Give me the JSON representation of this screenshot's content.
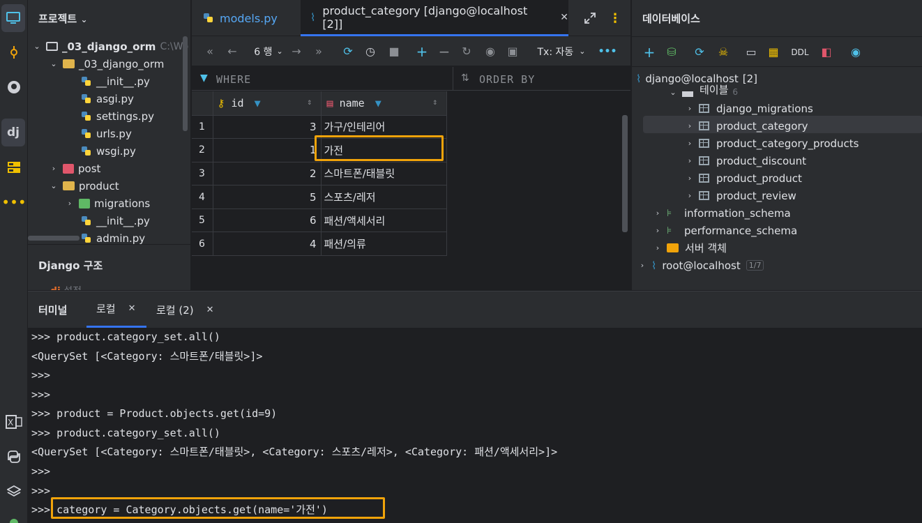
{
  "project": {
    "title": "프로젝트",
    "root": "_03_django_orm",
    "root_path": "C:\\Wo",
    "items": [
      "_03_django_orm",
      "__init__.py",
      "asgi.py",
      "settings.py",
      "urls.py",
      "wsgi.py",
      "post",
      "product",
      "migrations",
      "__init__.py",
      "admin.py"
    ],
    "django_structure": "Django 구조",
    "django_sub": "설정"
  },
  "editor": {
    "tabs": [
      "models.py",
      "product_category [django@localhost [2]]"
    ],
    "row_count": "6 행",
    "tx_label": "Tx: 자동",
    "where_label": "WHERE",
    "orderby_label": "ORDER BY",
    "columns": [
      "id",
      "name"
    ],
    "rows": [
      {
        "n": "1",
        "id": "3",
        "name": "가구/인테리어"
      },
      {
        "n": "2",
        "id": "1",
        "name": "가전"
      },
      {
        "n": "3",
        "id": "2",
        "name": "스마트폰/태블릿"
      },
      {
        "n": "4",
        "id": "5",
        "name": "스포츠/레저"
      },
      {
        "n": "5",
        "id": "6",
        "name": "패션/액세서리"
      },
      {
        "n": "6",
        "id": "4",
        "name": "패션/의류"
      }
    ]
  },
  "database": {
    "title": "데이터베이스",
    "ddl_label": "DDL",
    "connection": "django@localhost",
    "connection_count": "[2]",
    "tables_label": "테이블",
    "tables_count": "6",
    "tables": [
      "django_migrations",
      "product_category",
      "product_category_products",
      "product_discount",
      "product_product",
      "product_review"
    ],
    "schemas": [
      "information_schema",
      "performance_schema"
    ],
    "server_objects": "서버 객체",
    "root_connection": "root@localhost",
    "root_count": "1/7"
  },
  "terminal": {
    "title": "터미널",
    "tabs": [
      "로컬",
      "로컬 (2)"
    ],
    "lines": [
      ">>> product.category_set.all()",
      "<QuerySet [<Category: 스마트폰/태블릿>]>",
      ">>>",
      ">>>",
      ">>> product = Product.objects.get(id=9)",
      ">>> product.category_set.all()",
      "<QuerySet [<Category: 스마트폰/태블릿>, <Category: 스포츠/레저>, <Category: 패션/액세서리>]>",
      ">>>",
      ">>>",
      ">>> category = Category.objects.get(name='가전')"
    ]
  },
  "colors": {
    "accent": "#3574f0",
    "highlight": "#f0a30a"
  }
}
